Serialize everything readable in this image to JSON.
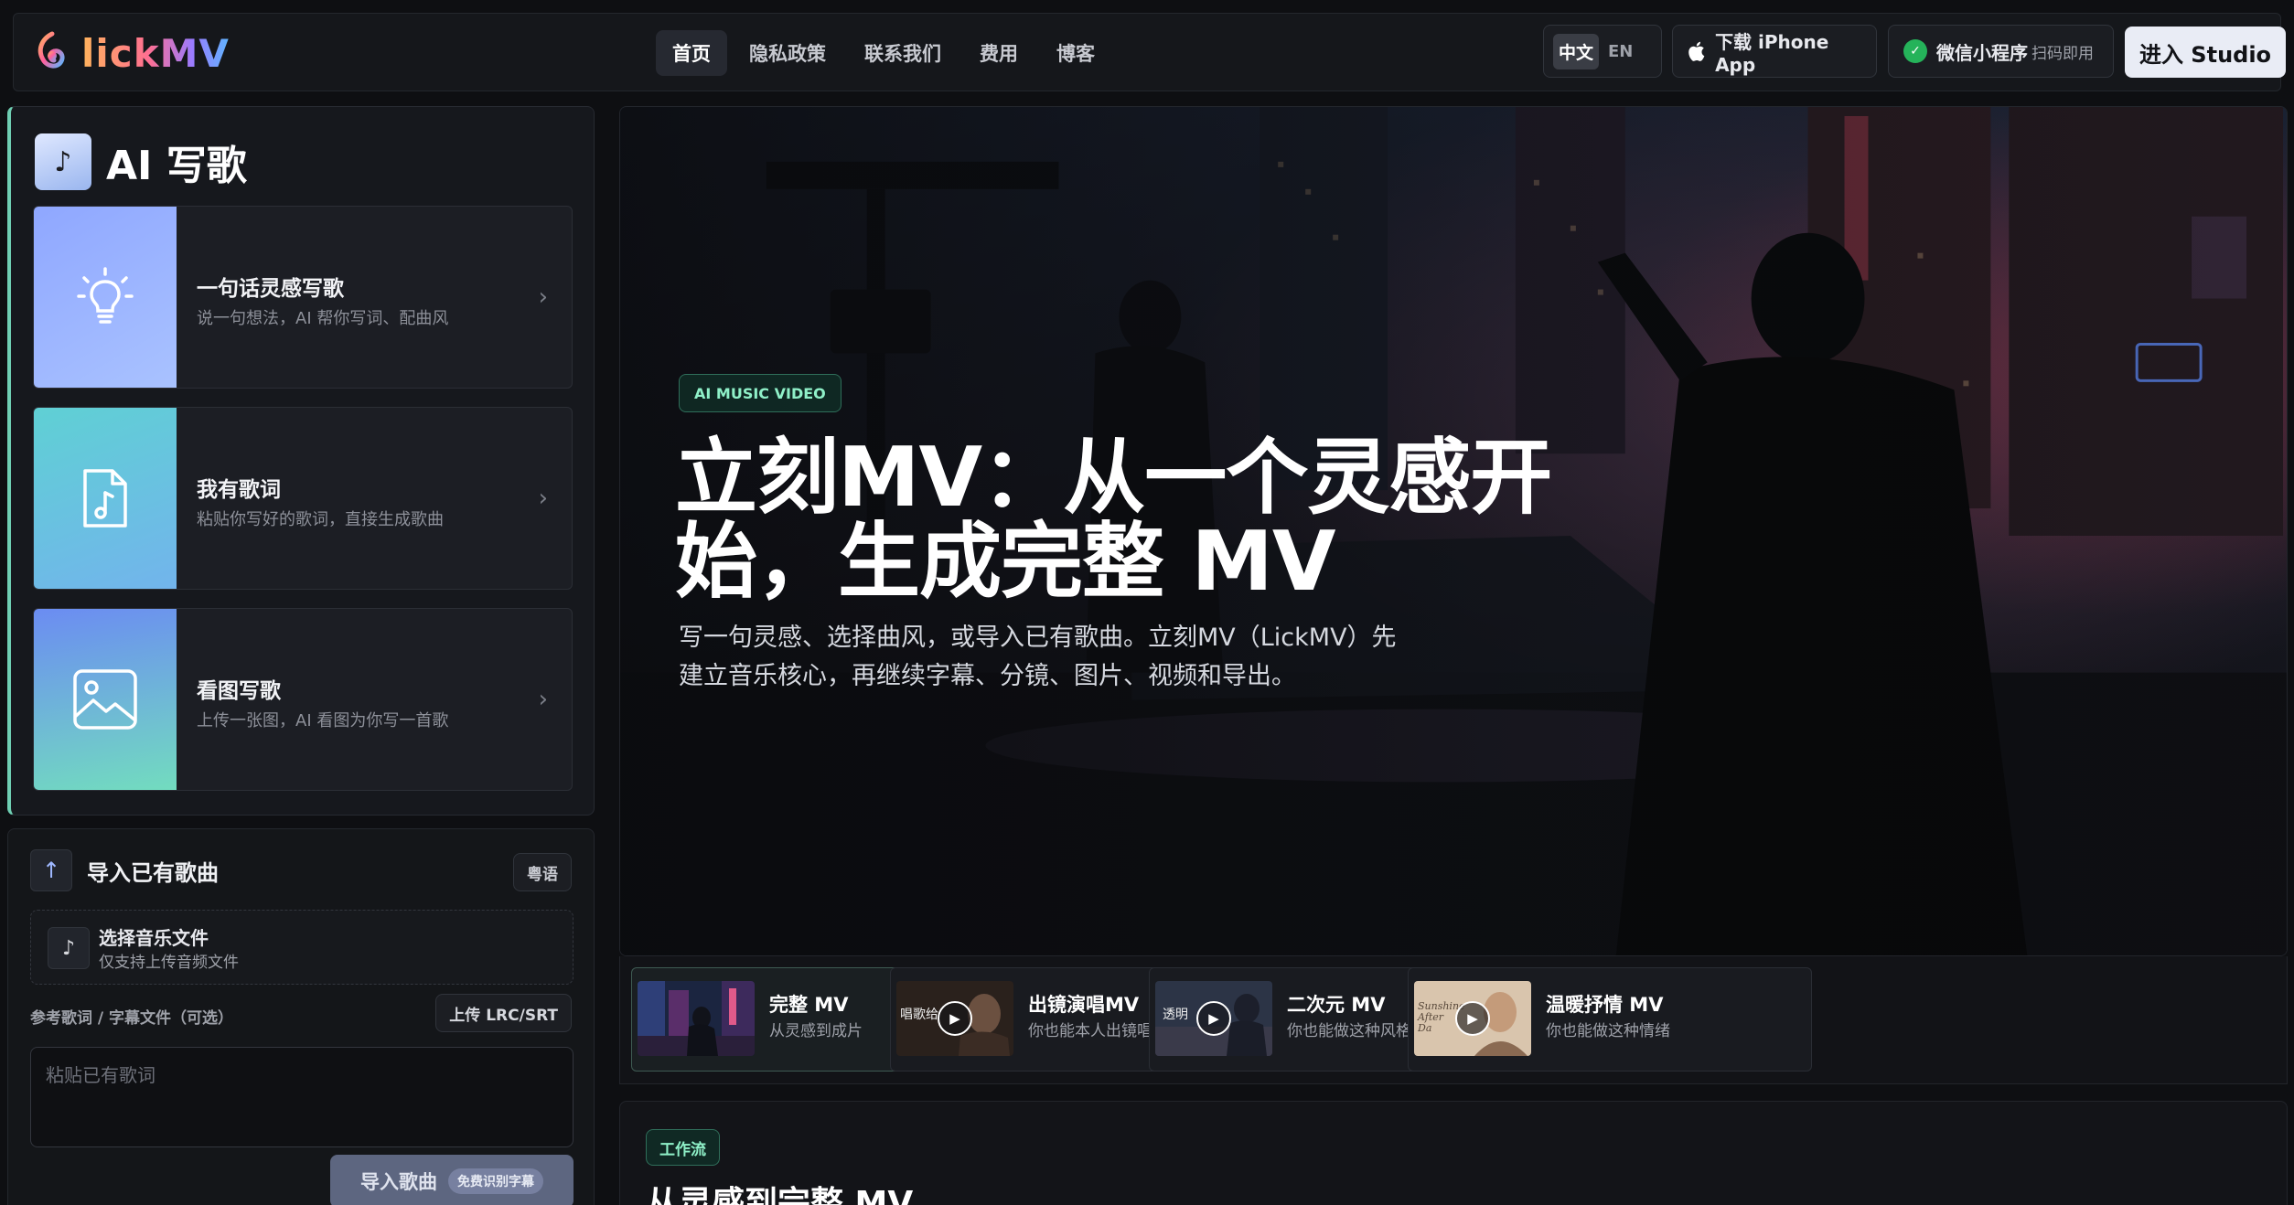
{
  "header": {
    "logo_text": "lickMV",
    "nav": [
      "首页",
      "隐私政策",
      "联系我们",
      "费用",
      "博客"
    ],
    "lang_active": "中文",
    "lang_other": "EN",
    "app_button": "下载 iPhone App",
    "wechat_button": "微信小程序",
    "wechat_sub": "扫码即用",
    "studio_button": "进入 Studio"
  },
  "ai_panel": {
    "title": "AI 写歌",
    "cards": [
      {
        "title": "一句话灵感写歌",
        "desc": "说一句想法，AI 帮你写词、配曲风",
        "icon": "lightbulb-icon"
      },
      {
        "title": "我有歌词",
        "desc": "粘贴你写好的歌词，直接生成歌曲",
        "icon": "music-file-icon"
      },
      {
        "title": "看图写歌",
        "desc": "上传一张图，AI 看图为你写一首歌",
        "icon": "image-icon"
      }
    ]
  },
  "import_panel": {
    "title": "导入已有歌曲",
    "badge": "粤语",
    "file_title": "选择音乐文件",
    "file_sub": "仅支持上传音频文件",
    "ref_label": "参考歌词 / 字幕文件（可选）",
    "upload_lrc": "上传 LRC/SRT",
    "lyric_placeholder": "粘贴已有歌词",
    "import_button": "导入歌曲",
    "import_tag": "免费识别字幕"
  },
  "hero": {
    "tag": "AI MUSIC VIDEO",
    "title_line1": "立刻MV：从一个灵感开",
    "title_line2": "始，生成完整 MV",
    "desc": "写一句灵感、选择曲风，或导入已有歌曲。立刻MV（LickMV）先建立音乐核心，再继续字幕、分镜、图片、视频和导出。"
  },
  "mv_types": [
    {
      "title": "完整 MV",
      "sub": "从灵感到成片"
    },
    {
      "title": "出镜演唱MV",
      "sub": "你也能本人出镜唱",
      "thumb_text": "唱歌给"
    },
    {
      "title": "二次元 MV",
      "sub": "你也能做这种风格",
      "thumb_text": "透明"
    },
    {
      "title": "温暖抒情 MV",
      "sub": "你也能做这种情绪",
      "thumb_text": "Sunshine After Da"
    }
  ],
  "workflow": {
    "tag": "工作流",
    "title": "从灵感到完整 MV"
  },
  "colors": {
    "accent_green": "#8ff0c8",
    "studio_bg": "#e9ecf5",
    "wechat_green": "#25b35a"
  }
}
